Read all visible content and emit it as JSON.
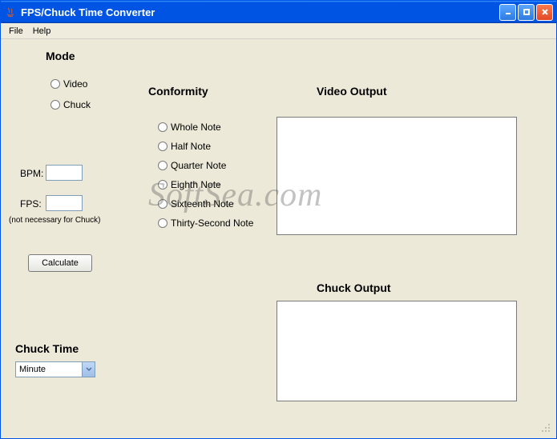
{
  "window": {
    "title": "FPS/Chuck Time Converter"
  },
  "menu": {
    "file": "File",
    "help": "Help"
  },
  "headings": {
    "mode": "Mode",
    "conformity": "Conformity",
    "video_output": "Video Output",
    "chuck_output": "Chuck Output",
    "chuck_time": "Chuck Time"
  },
  "mode": {
    "video": "Video",
    "chuck": "Chuck"
  },
  "fields": {
    "bpm_label": "BPM:",
    "bpm_value": "",
    "fps_label": "FPS:",
    "fps_value": "",
    "fps_note": "(not necessary for Chuck)"
  },
  "conformity": {
    "options": [
      "Whole Note",
      "Half Note",
      "Quarter Note",
      "Eighth Note",
      "Sixteenth Note",
      "Thirty-Second Note"
    ]
  },
  "buttons": {
    "calculate": "Calculate"
  },
  "chuck_time": {
    "selected": "Minute"
  },
  "outputs": {
    "video": "",
    "chuck": ""
  },
  "watermark": "SoftSea.com"
}
